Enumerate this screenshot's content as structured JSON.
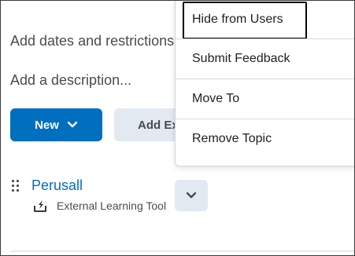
{
  "content": {
    "dates_restrictions": "Add dates and restrictions...",
    "description": "Add a description..."
  },
  "toolbar": {
    "new_label": "New",
    "add_existing_label": "Add Existing"
  },
  "topic": {
    "title": "Perusall",
    "type": "External Learning Tool"
  },
  "menu": {
    "items": [
      {
        "label": "Hide from Users",
        "focused": true
      },
      {
        "label": "Submit Feedback"
      },
      {
        "label": "Move To"
      },
      {
        "label": "Remove Topic"
      }
    ]
  },
  "colors": {
    "accent": "#006fbf",
    "secondary_button": "#e3e9f1",
    "text": "#494c4e"
  },
  "icons": {
    "new_chevron": "chevron-down-icon",
    "topic": "external-learning-tool-icon",
    "actions": "chevron-down-icon",
    "drag": "drag-handle-icon"
  }
}
